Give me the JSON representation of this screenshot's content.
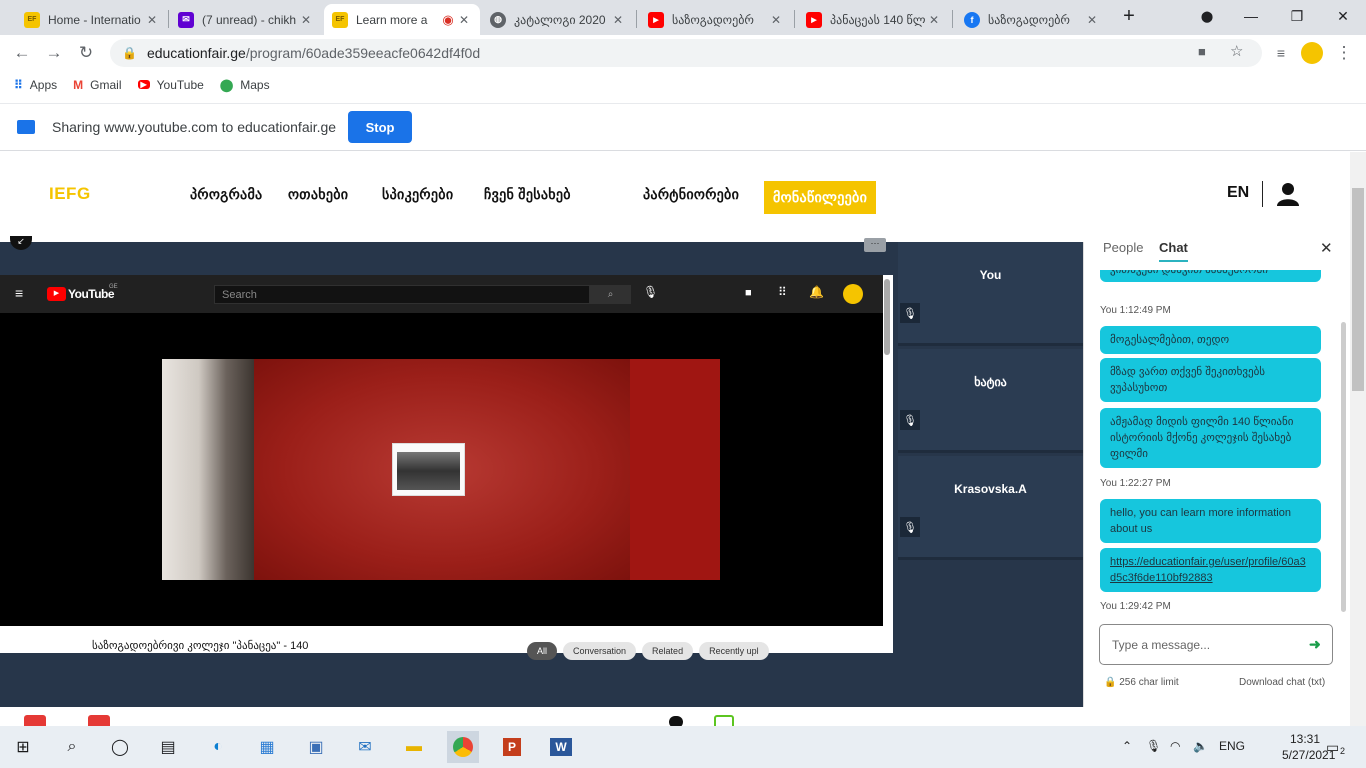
{
  "browser": {
    "tabs": [
      {
        "title": "Home - Internatio",
        "icon": "edu-fair-icon",
        "color": "#f5c400"
      },
      {
        "title": "(7 unread) - chikh",
        "icon": "mail-icon",
        "color": "#6001d2"
      },
      {
        "title": "Learn more a",
        "icon": "edu-fair-icon",
        "color": "#f5c400",
        "active": true
      },
      {
        "title": "კატალოგი 2020",
        "icon": "globe-icon",
        "color": "#5f6368"
      },
      {
        "title": "საზოგადოებრ",
        "icon": "youtube-icon",
        "color": "#ff0000"
      },
      {
        "title": "პანაცეას 140 წლ",
        "icon": "youtube-icon",
        "color": "#ff0000"
      },
      {
        "title": "საზოგადოებრ",
        "icon": "facebook-icon",
        "color": "#1877f2"
      }
    ],
    "favicon_text": "Edu Fair",
    "new_tab": "+",
    "url_host": "educationfair.ge",
    "url_path": "/program/60ade359eeacfe0642df4f0d",
    "bookmarks": [
      {
        "label": "Apps",
        "icon": "apps-grid-icon"
      },
      {
        "label": "Gmail",
        "icon": "gmail-icon"
      },
      {
        "label": "YouTube",
        "icon": "youtube-icon"
      },
      {
        "label": "Maps",
        "icon": "maps-pin-icon"
      }
    ]
  },
  "share_bar": {
    "text": "Sharing www.youtube.com to educationfair.ge",
    "stop_label": "Stop"
  },
  "site": {
    "logo": "IEFG",
    "menu": [
      "პროგრამა",
      "ოთახები",
      "სპიკერები",
      "ჩვენ შესახებ",
      "პარტნიორები"
    ],
    "highlight_menu": "მონაწილეები",
    "lang": "EN",
    "accent": "#f5c400"
  },
  "youtube": {
    "brand": "YouTube",
    "region": "GE",
    "search_placeholder": "Search",
    "video_title": "საზოგადოებრივი კოლეჯი \"პანაცეა\" - 140",
    "chips": [
      "All",
      "Conversation",
      "Related",
      "Recently upl"
    ]
  },
  "participants": [
    {
      "name": "You"
    },
    {
      "name": "ხატია"
    },
    {
      "name": "Krasovska.A"
    }
  ],
  "chat": {
    "tab_people": "People",
    "tab_chat": "Chat",
    "messages": [
      {
        "text": "კითხვები დასვით სასაუბროში`"
      },
      {
        "time": "You 1:12:49 PM"
      },
      {
        "text": "მოგესალმებით, თედო"
      },
      {
        "text": "მზად ვართ თქვენ შეკითხვებს ვუპასუხოთ"
      },
      {
        "text": "ამჟამად მიდის ფილმი 140 წლიანი ისტორიის მქონე კოლეჯის შესახებ ფილმი"
      },
      {
        "time": "You 1:22:27 PM"
      },
      {
        "text": "hello, you can learn more information about us"
      },
      {
        "link": "https://educationfair.ge/user/profile/60a3d5c3f6de110bf92883"
      },
      {
        "time": "You 1:29:42 PM"
      }
    ],
    "input_placeholder": "Type a message...",
    "char_limit": "256 char limit",
    "download": "Download chat (txt)",
    "bubble_color": "#16c6dd"
  },
  "taskbar": {
    "lang": "ENG",
    "time": "13:31",
    "date": "5/27/2021",
    "notification_count": "2",
    "apps": [
      "start-icon",
      "search-icon",
      "cortana-icon",
      "task-view-icon",
      "edge-icon",
      "control-panel-icon",
      "store-icon",
      "mail-icon",
      "file-explorer-icon",
      "chrome-icon",
      "powerpoint-icon",
      "word-icon"
    ]
  }
}
